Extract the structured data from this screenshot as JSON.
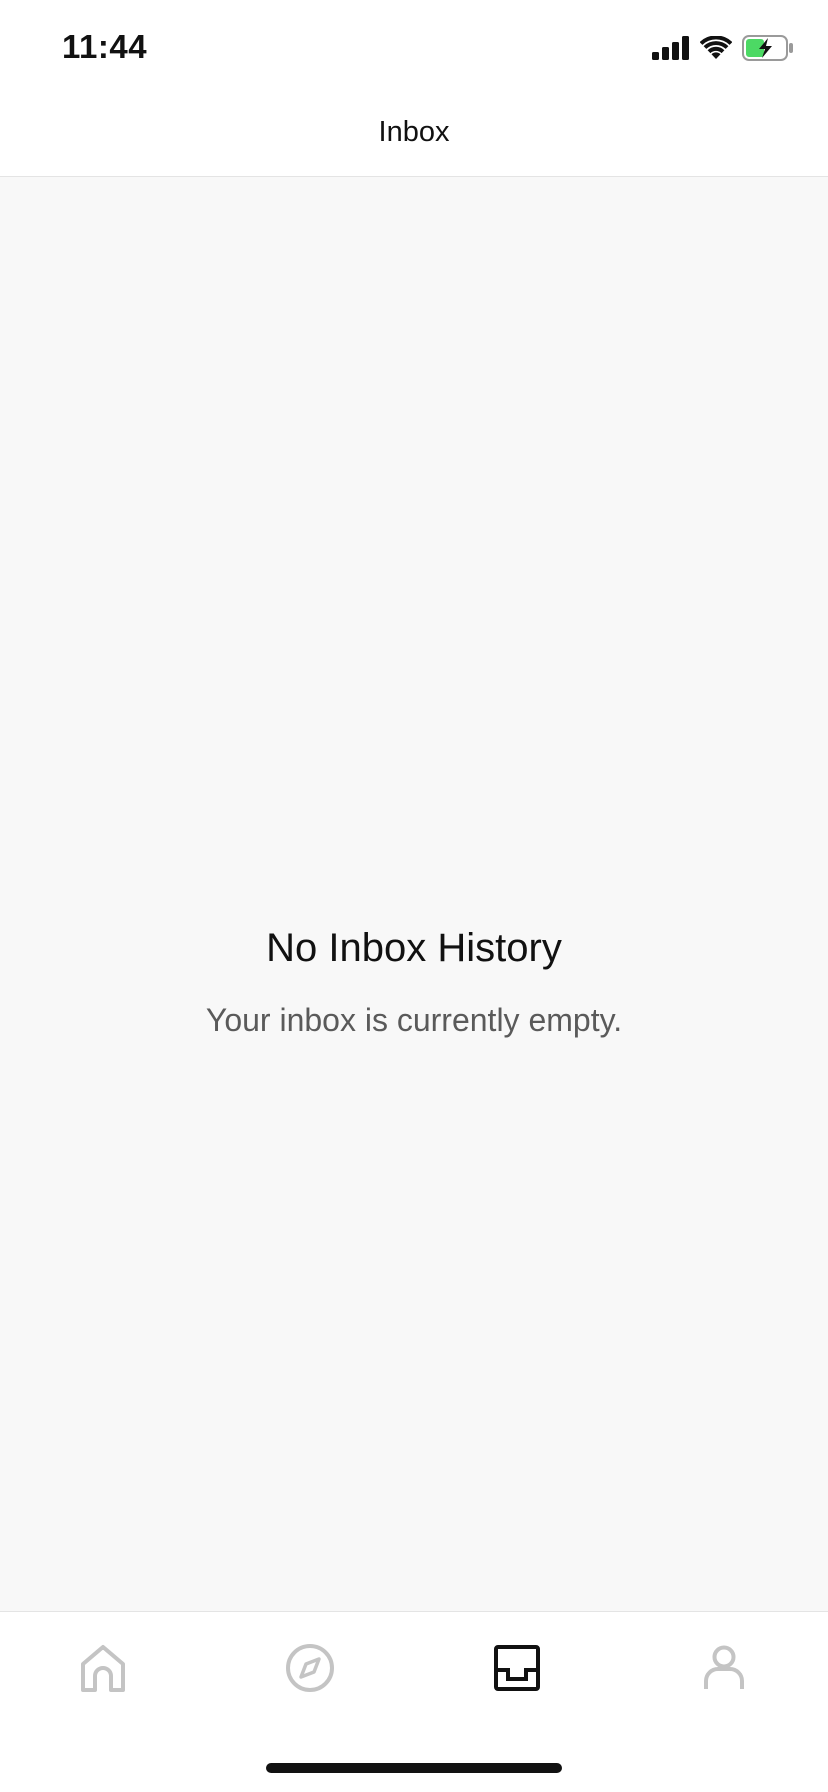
{
  "status_bar": {
    "time": "11:44",
    "icons": [
      "signal-icon",
      "wifi-icon",
      "battery-charging-icon"
    ],
    "battery_color": "#4cd964"
  },
  "nav": {
    "title": "Inbox"
  },
  "empty_state": {
    "title": "No Inbox History",
    "subtitle": "Your inbox is currently empty."
  },
  "tab_bar": {
    "active_tab": "inbox",
    "active_color": "#111111",
    "inactive_color": "#c4c4c4",
    "tabs": [
      {
        "id": "home",
        "icon": "home-icon"
      },
      {
        "id": "discover",
        "icon": "compass-icon"
      },
      {
        "id": "inbox",
        "icon": "inbox-tray-icon"
      },
      {
        "id": "profile",
        "icon": "person-icon"
      }
    ]
  }
}
